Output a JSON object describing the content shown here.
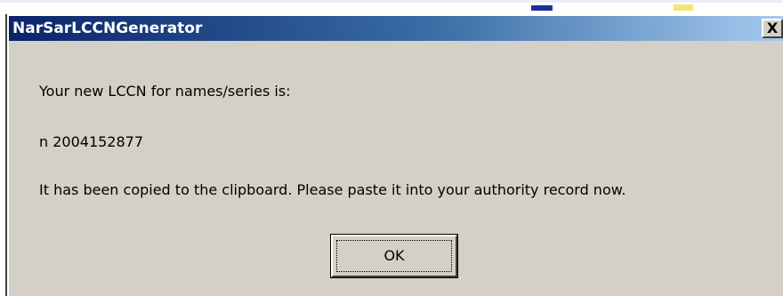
{
  "window": {
    "title": "NarSarLCCNGenerator",
    "close_glyph": "X",
    "accent_color": "#0a246a"
  },
  "message": {
    "line1": "Your new LCCN for names/series is:",
    "lccn": "n 2004152877",
    "line3": "It has been copied to the clipboard.  Please paste it into your authority record now."
  },
  "buttons": {
    "ok_label": "OK"
  }
}
